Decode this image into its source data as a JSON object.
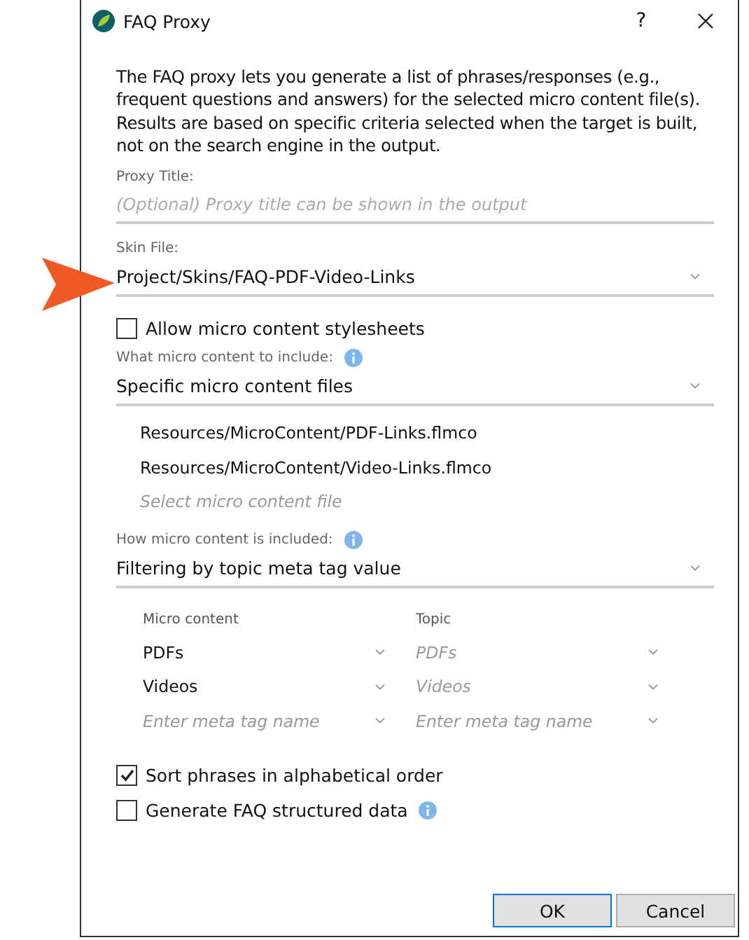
{
  "window": {
    "title": "FAQ Proxy",
    "help": "?"
  },
  "intro": "The FAQ proxy lets you generate a list of phrases/responses (e.g., frequent questions and answers) for the selected micro content file(s). Results are based on specific criteria selected when the target is built, not on the search engine in the output.",
  "proxy_title": {
    "label": "Proxy Title:",
    "placeholder": "(Optional) Proxy title can be shown in the output"
  },
  "skin_file": {
    "label": "Skin File:",
    "value": "Project/Skins/FAQ-PDF-Video-Links"
  },
  "allow_stylesheets": {
    "label": "Allow micro content stylesheets",
    "checked": false
  },
  "what_to_include": {
    "label": "What micro content to include:",
    "value": "Specific micro content files"
  },
  "files": [
    "Resources/MicroContent/PDF-Links.flmco",
    "Resources/MicroContent/Video-Links.flmco"
  ],
  "file_placeholder": "Select micro content file",
  "how_included": {
    "label": "How micro content is included:",
    "value": "Filtering by topic meta tag value"
  },
  "mapping": {
    "columns": [
      "Micro content",
      "Topic"
    ],
    "rows": [
      {
        "micro": {
          "value": "PDFs"
        },
        "topic": {
          "placeholder": "PDFs"
        }
      },
      {
        "micro": {
          "value": "Videos"
        },
        "topic": {
          "placeholder": "Videos"
        }
      },
      {
        "micro": {
          "placeholder": "Enter meta tag name"
        },
        "topic": {
          "placeholder": "Enter meta tag name"
        }
      }
    ]
  },
  "options": [
    {
      "label": "Sort phrases in alphabetical order",
      "checked": true,
      "info": false
    },
    {
      "label": "Generate FAQ structured data",
      "checked": false,
      "info": true
    }
  ],
  "buttons": [
    {
      "label": "OK",
      "default": true
    },
    {
      "label": "Cancel",
      "default": false
    }
  ]
}
